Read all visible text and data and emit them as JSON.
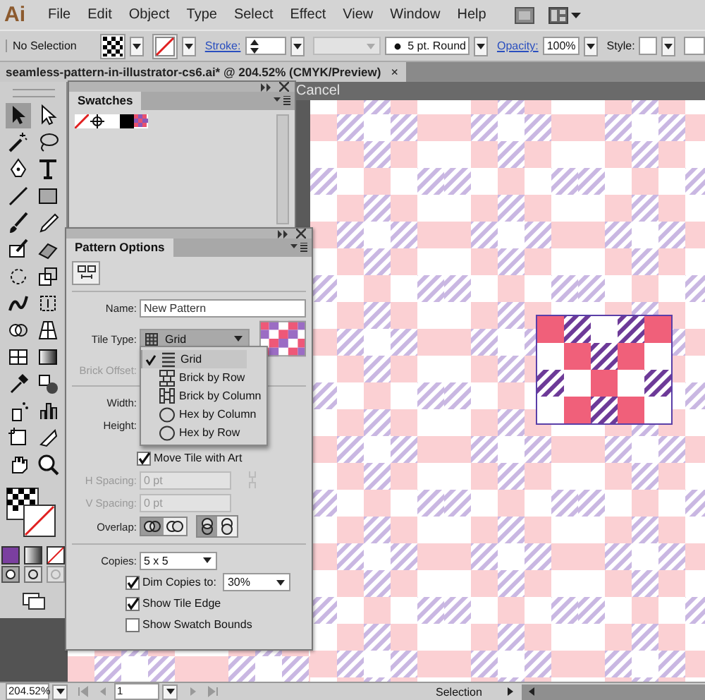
{
  "menu_bar": {
    "logo": "Ai",
    "items": [
      "File",
      "Edit",
      "Object",
      "Type",
      "Select",
      "Effect",
      "View",
      "Window",
      "Help"
    ]
  },
  "control_bar": {
    "selection": "No Selection",
    "stroke_label": "Stroke:",
    "brush": "5 pt. Round",
    "opacity_label": "Opacity:",
    "opacity": "100%",
    "style_label": "Style:"
  },
  "document_tab": {
    "title": "seamless-pattern-in-illustrator-cs6.ai* @ 204.52% (CMYK/Preview)",
    "close": "×"
  },
  "edit_bar": {
    "cancel": "Cancel"
  },
  "swatches_panel": {
    "title": "Swatches"
  },
  "pattern_options": {
    "title": "Pattern Options",
    "name_label": "Name:",
    "name": "New Pattern",
    "tile_type_label": "Tile Type:",
    "tile_type": "Grid",
    "brick_offset_label": "Brick Offset:",
    "tile_type_menu": [
      {
        "label": "Grid",
        "kind": "grid",
        "selected": true
      },
      {
        "label": "Brick by Row",
        "kind": "brick_row",
        "selected": false
      },
      {
        "label": "Brick by Column",
        "kind": "brick_column",
        "selected": false
      },
      {
        "label": "Hex by Column",
        "kind": "hex",
        "selected": false
      },
      {
        "label": "Hex by Row",
        "kind": "hex",
        "selected": false
      }
    ],
    "width_label": "Width:",
    "height_label": "Height:",
    "move_tile": {
      "label": "Move Tile with Art",
      "checked": true
    },
    "h_spacing_label": "H Spacing:",
    "h_spacing": "0 pt",
    "v_spacing_label": "V Spacing:",
    "v_spacing": "0 pt",
    "overlap_label": "Overlap:",
    "copies_label": "Copies:",
    "copies": "5 x 5",
    "dim_copies": {
      "label": "Dim Copies to:",
      "checked": true,
      "value": "30%"
    },
    "show_tile_edge": {
      "label": "Show Tile Edge",
      "checked": true
    },
    "show_swatch_bounds": {
      "label": "Show Swatch Bounds",
      "checked": false
    }
  },
  "status_bar": {
    "zoom": "204.52%",
    "page": "1",
    "tool": "Selection"
  }
}
